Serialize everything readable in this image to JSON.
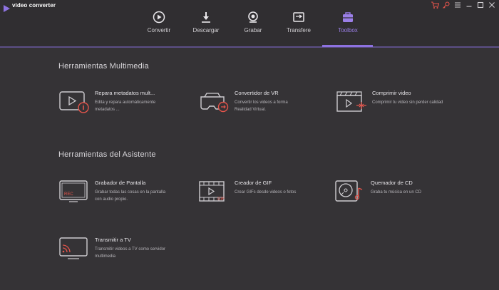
{
  "app": {
    "title": "video converter"
  },
  "tabs": [
    {
      "id": "convertir",
      "label": "Convertir",
      "icon": "play-circle-icon"
    },
    {
      "id": "descargar",
      "label": "Descargar",
      "icon": "download-icon"
    },
    {
      "id": "grabar",
      "label": "Grabar",
      "icon": "record-icon"
    },
    {
      "id": "transfer",
      "label": "Transfere",
      "icon": "transfer-icon"
    },
    {
      "id": "toolbox",
      "label": "Toolbox",
      "icon": "toolbox-icon",
      "active": true
    }
  ],
  "sections": [
    {
      "title": "Herramientas Multimedia",
      "tools": [
        {
          "name": "Repara metadatos mult...",
          "desc": "Edita y repara automáticamente metadatos ...",
          "icon": "fix-metadata-icon"
        },
        {
          "name": "Convertidor de VR",
          "desc": "Convertir los videos a forma Realidad Virtual.",
          "icon": "vr-headset-icon"
        },
        {
          "name": "Comprimir video",
          "desc": "Comprimir tu video sin perder calidad",
          "icon": "compress-video-icon"
        }
      ]
    },
    {
      "title": "Herramientas del Asistente",
      "tools": [
        {
          "name": "Grabador de Pantalla",
          "desc": "Grabar todas las cosas en la pantalla con audio propio.",
          "icon": "screen-recorder-icon",
          "badge": "REC"
        },
        {
          "name": "Creador de GIF",
          "desc": "Crear GIFs desde videos o fotos",
          "icon": "gif-maker-icon",
          "badge": "GIF"
        },
        {
          "name": "Quemador de CD",
          "desc": "Graba tu música en un CD",
          "icon": "cd-burner-icon"
        },
        {
          "name": "Transmitir a TV",
          "desc": "Transmitir videos a TV como servidor multimedia",
          "icon": "cast-to-tv-icon"
        }
      ]
    }
  ],
  "colors": {
    "background": "#353336",
    "accent": "#8d72e0",
    "icon_red": "#e4544b",
    "line": "#cfcdd1"
  }
}
